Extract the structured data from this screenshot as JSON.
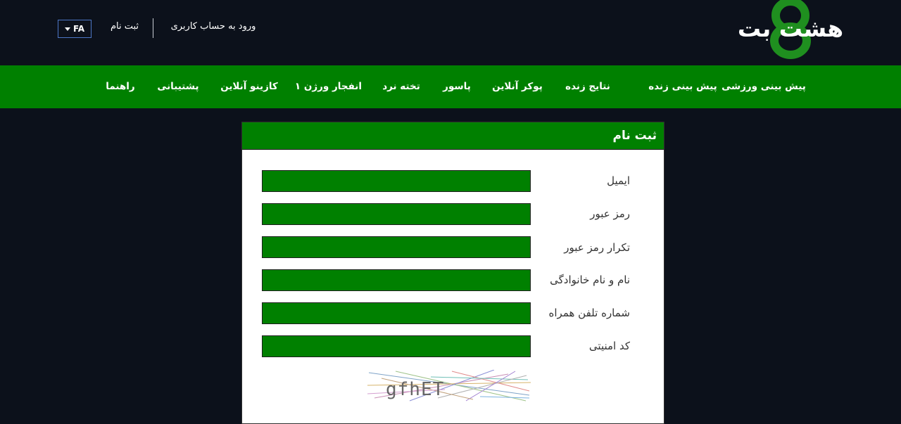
{
  "header": {
    "logo_text": "هشت بت",
    "language": "FA",
    "register_link": "ثبت نام",
    "login_link": "ورود به حساب کاربری"
  },
  "nav": {
    "items": [
      "پیش بینی ورزشی",
      "پیش بینی زنده",
      "نتایج زنده",
      "پوکر آنلاین",
      "پاسور",
      "تخته نرد",
      "انفجار ورژن ۱",
      "کازینو آنلاین",
      "پشتیبانی",
      "راهنما"
    ]
  },
  "form": {
    "title": "ثبت نام",
    "fields": [
      {
        "label": "ایمیل",
        "value": ""
      },
      {
        "label": "رمز عبور",
        "value": ""
      },
      {
        "label": "تکرار رمز عبور",
        "value": ""
      },
      {
        "label": "نام و نام خانوادگی",
        "value": ""
      },
      {
        "label": "شماره تلفن همراه",
        "value": ""
      },
      {
        "label": "کد امنیتی",
        "value": ""
      }
    ],
    "captcha_text": "gfhET"
  },
  "colors": {
    "background": "#0c111b",
    "nav_green": "#008000",
    "input_green": "#008000",
    "panel_background": "#ffffff",
    "logo_green": "#1f8f1f"
  }
}
